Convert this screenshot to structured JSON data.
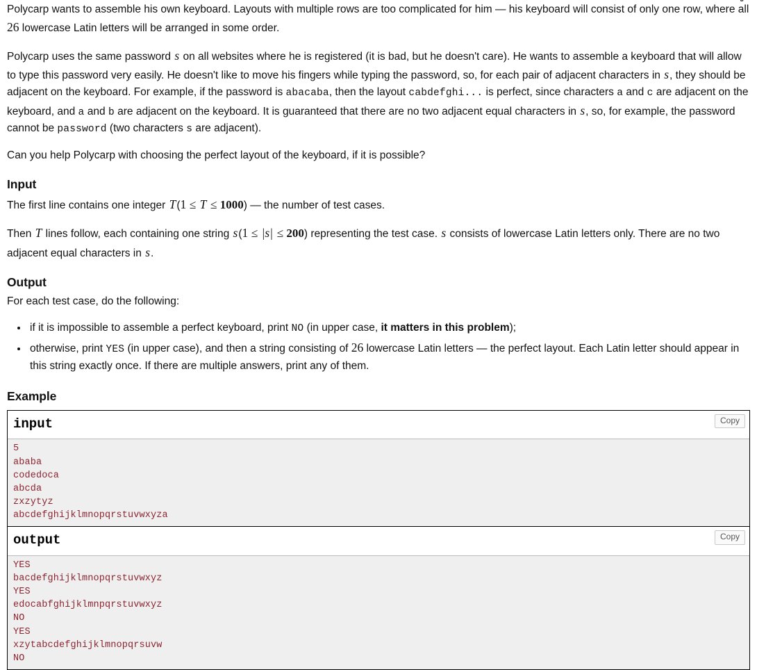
{
  "problem": {
    "statement": {
      "p1_a": "Polycarp wants to assemble his own keyboard. Layouts with multiple rows are too complicated for him — his keyboard will consist of only one row, where all ",
      "p1_n": "26",
      "p1_b": " lowercase Latin letters will be arranged in some order.",
      "p2_a": "Polycarp uses the same password ",
      "p2_s1": "s",
      "p2_b": " on all websites where he is registered (it is bad, but he doesn't care). He wants to assemble a keyboard that will allow to type this password very easily. He doesn't like to move his fingers while typing the password, so, for each pair of adjacent characters in ",
      "p2_s2": "s",
      "p2_c": ", they should be adjacent on the keyboard. For example, if the password is ",
      "p2_code1": "abacaba",
      "p2_d": ", then the layout ",
      "p2_code2": "cabdefghi...",
      "p2_e": " is perfect, since characters ",
      "p2_code3": "a",
      "p2_f": " and ",
      "p2_code4": "c",
      "p2_g": " are adjacent on the keyboard, and ",
      "p2_code5": "a",
      "p2_h": " and ",
      "p2_code6": "b",
      "p2_i": " are adjacent on the keyboard. It is guaranteed that there are no two adjacent equal characters in ",
      "p2_s3": "s",
      "p2_j": ", so, for example, the password cannot be ",
      "p2_code7": "password",
      "p2_k": " (two characters ",
      "p2_code8": "s",
      "p2_l": " are adjacent).",
      "p3": "Can you help Polycarp with choosing the perfect layout of the keyboard, if it is possible?"
    },
    "input_section": {
      "heading": "Input",
      "line1_a": "The first line contains one integer ",
      "line1_T": "T",
      "line1_paren_open": "(",
      "line1_math": "1 ≤ ",
      "line1_T2": "T",
      "line1_math2": " ≤ ",
      "line1_num": "1000",
      "line1_paren_close": ")",
      "line1_b": " — the number of test cases.",
      "line2_a": "Then ",
      "line2_T": "T",
      "line2_b": " lines follow, each containing one string ",
      "line2_s": "s",
      "line2_paren_open": "(",
      "line2_m1": "1 ≤ ",
      "line2_abs": "|s|",
      "line2_m2": " ≤ ",
      "line2_num": "200",
      "line2_paren_close": ")",
      "line2_c": " representing the test case. ",
      "line2_s2": "s",
      "line2_d": " consists of lowercase Latin letters only. There are no two adjacent equal characters in ",
      "line2_s3": "s",
      "line2_e": "."
    },
    "output_section": {
      "heading": "Output",
      "intro": "For each test case, do the following:",
      "bullets": [
        {
          "a": "if it is impossible to assemble a perfect keyboard, print ",
          "code": "NO",
          "b": " (in upper case, ",
          "bold": "it matters in this problem",
          "c": ");"
        },
        {
          "a": "otherwise, print ",
          "code": "YES",
          "b": " (in upper case), and then a string consisting of ",
          "num": "26",
          "c": " lowercase Latin letters — the perfect layout. Each Latin letter should appear in this string exactly once. If there are multiple answers, print any of them."
        }
      ]
    },
    "example_section": {
      "heading": "Example",
      "copy_label": "Copy",
      "blocks": [
        {
          "title": "input",
          "content": "5\nababa\ncodedoca\nabcda\nzxzytyz\nabcdefghijklmnopqrstuvwxyza"
        },
        {
          "title": "output",
          "content": "YES\nbacdefghijklmnopqrstuvwxyz\nYES\nedocabfghijklmnpqrstuvwxyz\nNO\nYES\nxzytabcdefghijklmnopqrsuvw\nNO"
        }
      ]
    }
  },
  "colors": {
    "code_text": "#8b2531",
    "sample_bg": "#efefef",
    "border": "#000000"
  }
}
